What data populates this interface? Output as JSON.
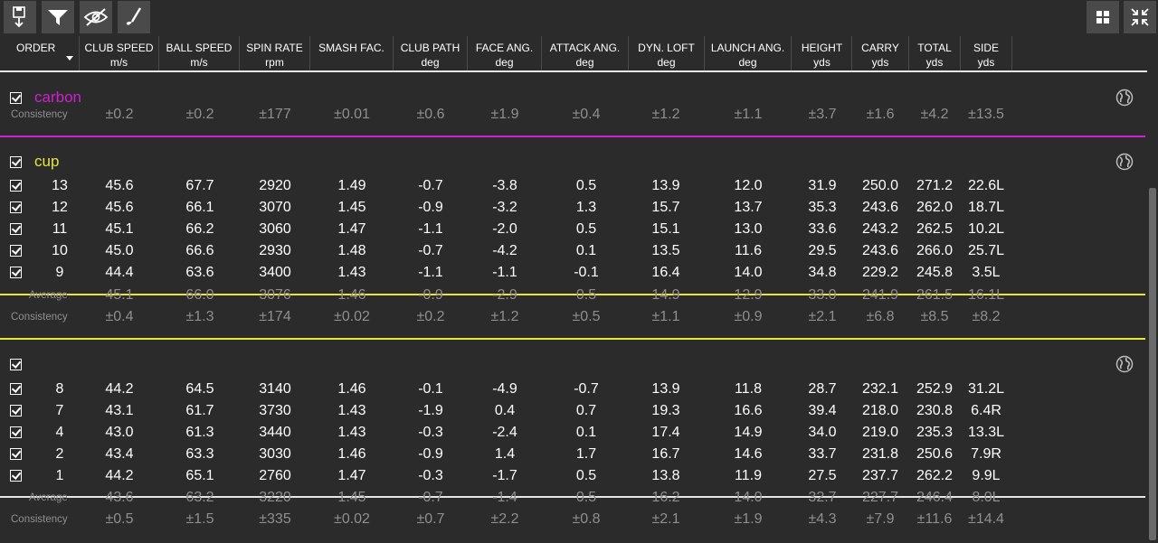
{
  "colors": {
    "carbon_accent": "#d21fd2",
    "cup_accent": "#e8e635",
    "unnamed_accent": "#e6e6e6"
  },
  "toolbar": {
    "left_icons": [
      "save-down-icon",
      "filter-play-icon",
      "hide-eye-icon",
      "golf-club-icon"
    ],
    "right_icons": [
      "grid-view-icon",
      "collapse-icon"
    ]
  },
  "columns": [
    {
      "label": "ORDER",
      "unit": ""
    },
    {
      "label": "CLUB SPEED",
      "unit": "m/s"
    },
    {
      "label": "BALL SPEED",
      "unit": "m/s"
    },
    {
      "label": "SPIN RATE",
      "unit": "rpm"
    },
    {
      "label": "SMASH FAC.",
      "unit": ""
    },
    {
      "label": "CLUB PATH",
      "unit": "deg"
    },
    {
      "label": "FACE ANG.",
      "unit": "deg"
    },
    {
      "label": "ATTACK ANG.",
      "unit": "deg"
    },
    {
      "label": "DYN. LOFT",
      "unit": "deg"
    },
    {
      "label": "LAUNCH ANG.",
      "unit": "deg"
    },
    {
      "label": "HEIGHT",
      "unit": "yds"
    },
    {
      "label": "CARRY",
      "unit": "yds"
    },
    {
      "label": "TOTAL",
      "unit": "yds"
    },
    {
      "label": "SIDE",
      "unit": "yds"
    }
  ],
  "groups": [
    {
      "name": "carbon",
      "shots": [],
      "average": null,
      "consistency_label": "Consistency",
      "consistency": [
        "±0.2",
        "±0.2",
        "±177",
        "±0.01",
        "±0.6",
        "±1.9",
        "±0.4",
        "±1.2",
        "±1.1",
        "±3.7",
        "±1.6",
        "±4.2",
        "±13.5"
      ]
    },
    {
      "name": "cup",
      "shots": [
        {
          "order": "13",
          "values": [
            "45.6",
            "67.7",
            "2920",
            "1.49",
            "-0.7",
            "-3.8",
            "0.5",
            "13.9",
            "12.0",
            "31.9",
            "250.0",
            "271.2",
            "22.6L"
          ]
        },
        {
          "order": "12",
          "values": [
            "45.6",
            "66.1",
            "3070",
            "1.45",
            "-0.9",
            "-3.2",
            "1.3",
            "15.7",
            "13.7",
            "35.3",
            "243.6",
            "262.0",
            "18.7L"
          ]
        },
        {
          "order": "11",
          "values": [
            "45.1",
            "66.2",
            "3060",
            "1.47",
            "-1.1",
            "-2.0",
            "0.5",
            "15.1",
            "13.0",
            "33.6",
            "243.2",
            "262.5",
            "10.2L"
          ]
        },
        {
          "order": "10",
          "values": [
            "45.0",
            "66.6",
            "2930",
            "1.48",
            "-0.7",
            "-4.2",
            "0.1",
            "13.5",
            "11.6",
            "29.5",
            "243.6",
            "266.0",
            "25.7L"
          ]
        },
        {
          "order": "9",
          "values": [
            "44.4",
            "63.6",
            "3400",
            "1.43",
            "-1.1",
            "-1.1",
            "-0.1",
            "16.4",
            "14.0",
            "34.8",
            "229.2",
            "245.8",
            "3.5L"
          ]
        }
      ],
      "average_label": "Average",
      "average": [
        "45.1",
        "66.0",
        "3076",
        "1.46",
        "-0.9",
        "-2.9",
        "0.5",
        "14.9",
        "12.9",
        "33.0",
        "241.9",
        "261.5",
        "16.1L"
      ],
      "consistency_label": "Consistency",
      "consistency": [
        "±0.4",
        "±1.3",
        "±174",
        "±0.02",
        "±0.2",
        "±1.2",
        "±0.5",
        "±1.1",
        "±0.9",
        "±2.1",
        "±6.8",
        "±8.5",
        "±8.2"
      ]
    },
    {
      "name": "",
      "shots": [
        {
          "order": "8",
          "values": [
            "44.2",
            "64.5",
            "3140",
            "1.46",
            "-0.1",
            "-4.9",
            "-0.7",
            "13.9",
            "11.8",
            "28.7",
            "232.1",
            "252.9",
            "31.2L"
          ]
        },
        {
          "order": "7",
          "values": [
            "43.1",
            "61.7",
            "3730",
            "1.43",
            "-1.9",
            "0.4",
            "0.7",
            "19.3",
            "16.6",
            "39.4",
            "218.0",
            "230.8",
            "6.4R"
          ]
        },
        {
          "order": "4",
          "values": [
            "43.0",
            "61.3",
            "3440",
            "1.43",
            "-0.3",
            "-2.4",
            "0.1",
            "17.4",
            "14.9",
            "34.0",
            "219.0",
            "235.3",
            "13.3L"
          ]
        },
        {
          "order": "2",
          "values": [
            "43.4",
            "63.3",
            "3030",
            "1.46",
            "-0.9",
            "1.4",
            "1.7",
            "16.7",
            "14.6",
            "33.7",
            "231.8",
            "250.6",
            "7.9R"
          ]
        },
        {
          "order": "1",
          "values": [
            "44.2",
            "65.1",
            "2760",
            "1.47",
            "-0.3",
            "-1.7",
            "0.5",
            "13.8",
            "11.9",
            "27.5",
            "237.7",
            "262.2",
            "9.9L"
          ]
        }
      ],
      "average_label": "Average",
      "average": [
        "43.6",
        "63.2",
        "3220",
        "1.45",
        "-0.7",
        "-1.4",
        "0.5",
        "16.2",
        "14.0",
        "32.7",
        "227.7",
        "246.4",
        "8.0L"
      ],
      "consistency_label": "Consistency",
      "consistency": [
        "±0.5",
        "±1.5",
        "±335",
        "±0.02",
        "±0.7",
        "±2.2",
        "±0.8",
        "±2.1",
        "±1.9",
        "±4.3",
        "±7.9",
        "±11.6",
        "±14.4"
      ]
    }
  ]
}
